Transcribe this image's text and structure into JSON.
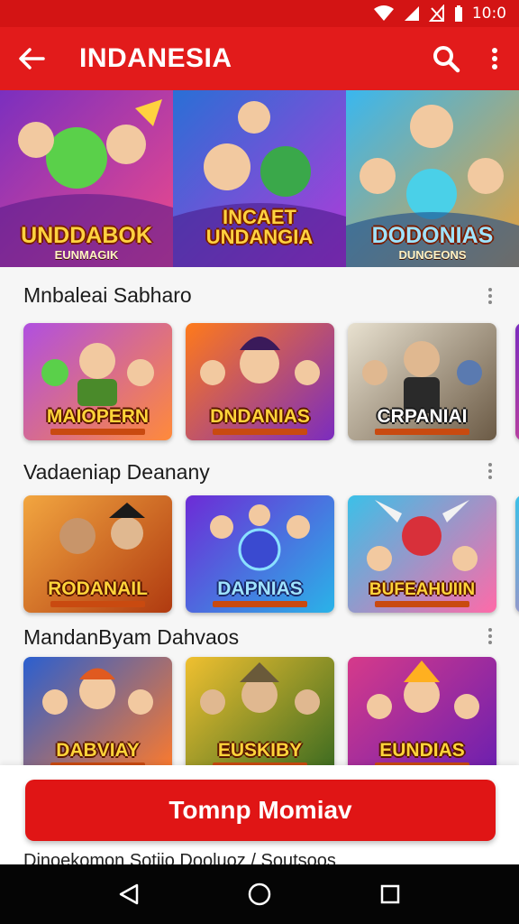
{
  "status_bar": {
    "time": "10:0"
  },
  "app_bar": {
    "title": "INDANESIA"
  },
  "hero": [
    {
      "title": "UNDDABOK",
      "subtitle": "EUNMAGIK",
      "bg": [
        "#7b2fbf",
        "#f04a8a"
      ]
    },
    {
      "title": "INCAET UNDANGIA",
      "subtitle": "",
      "bg": [
        "#2a6fd6",
        "#b23ad8"
      ]
    },
    {
      "title": "DODONIAS",
      "subtitle": "DUNGEONS",
      "bg": [
        "#39b7ef",
        "#e7a03a"
      ]
    }
  ],
  "sections": [
    {
      "title": "Mnbaleai Sabharo",
      "cards": [
        {
          "label": "MAIOPERN",
          "bg": [
            "#b04fe0",
            "#ff8a3a"
          ]
        },
        {
          "label": "DNDANIAS",
          "bg": [
            "#ff7a1a",
            "#7b2cbf"
          ]
        },
        {
          "label": "CRPANIAI",
          "bg": [
            "#e8e1d0",
            "#6b5a45"
          ]
        },
        {
          "label": "",
          "bg": [
            "#7b2cbf",
            "#ff5a7a"
          ]
        }
      ]
    },
    {
      "title": "Vadaeniap Deanany",
      "cards": [
        {
          "label": "RODANAIL",
          "bg": [
            "#f2a640",
            "#b03a10"
          ]
        },
        {
          "label": "DAPNIAS",
          "bg": [
            "#6d2bd6",
            "#2ab3e8"
          ]
        },
        {
          "label": "BUFEAHUIIN",
          "bg": [
            "#3bc0e8",
            "#ff6aa8"
          ]
        },
        {
          "label": "",
          "bg": [
            "#3bc0e8",
            "#ff6aa8"
          ]
        }
      ]
    },
    {
      "title": "MandanByam Dahvaos",
      "cards": [
        {
          "label": "DABVIAY",
          "bg": [
            "#2a5fd0",
            "#ff7a2a"
          ]
        },
        {
          "label": "EUSKIBY",
          "bg": [
            "#f0c030",
            "#3a6a20"
          ]
        },
        {
          "label": "EUNDIAS",
          "bg": [
            "#d63a8a",
            "#6b1fb0"
          ]
        }
      ]
    }
  ],
  "bottom": {
    "button_label": "Tomnp Momiav",
    "footer_text": "Dinoekomon Sotiio Dooluoz / Soutsoos"
  },
  "colors": {
    "primary": "#e21b1b",
    "status": "#d31414",
    "nav": "#050505"
  },
  "icons": [
    "back-arrow-icon",
    "search-icon",
    "more-vert-icon",
    "wifi-icon",
    "signal-icon",
    "battery-icon",
    "nav-back-icon",
    "nav-home-icon",
    "nav-recents-icon"
  ]
}
